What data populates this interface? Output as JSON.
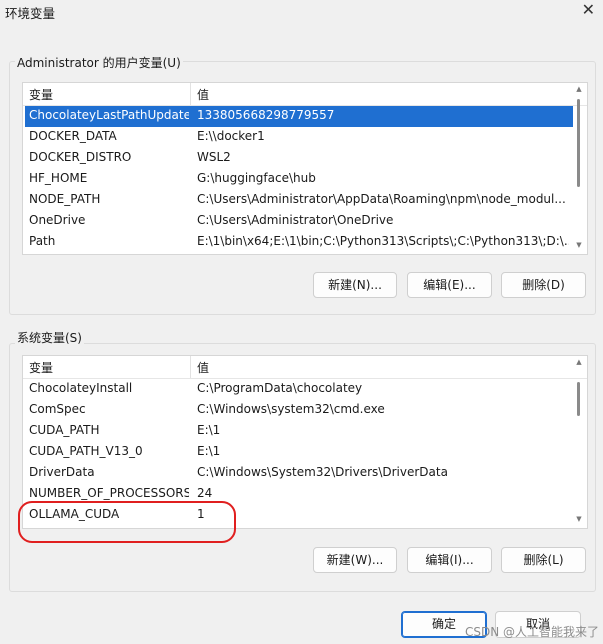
{
  "window": {
    "title": "环境变量",
    "close_glyph": "✕"
  },
  "user_group": {
    "label": "Administrator 的用户变量(U)",
    "columns": {
      "name": "变量",
      "value": "值"
    },
    "rows": [
      {
        "name": "ChocolateyLastPathUpdate",
        "value": "133805668298779557",
        "selected": true
      },
      {
        "name": "DOCKER_DATA",
        "value": "E:\\\\docker1"
      },
      {
        "name": "DOCKER_DISTRO",
        "value": "WSL2"
      },
      {
        "name": "HF_HOME",
        "value": "G:\\huggingface\\hub"
      },
      {
        "name": "NODE_PATH",
        "value": "C:\\Users\\Administrator\\AppData\\Roaming\\npm\\node_modul..."
      },
      {
        "name": "OneDrive",
        "value": "C:\\Users\\Administrator\\OneDrive"
      },
      {
        "name": "Path",
        "value": "E:\\1\\bin\\x64;E:\\1\\bin;C:\\Python313\\Scripts\\;C:\\Python313\\;D:\\..."
      }
    ],
    "buttons": {
      "new": "新建(N)...",
      "edit": "编辑(E)...",
      "delete": "删除(D)"
    }
  },
  "system_group": {
    "label": "系统变量(S)",
    "columns": {
      "name": "变量",
      "value": "值"
    },
    "rows": [
      {
        "name": "ChocolateyInstall",
        "value": "C:\\ProgramData\\chocolatey"
      },
      {
        "name": "ComSpec",
        "value": "C:\\Windows\\system32\\cmd.exe"
      },
      {
        "name": "CUDA_PATH",
        "value": "E:\\1"
      },
      {
        "name": "CUDA_PATH_V13_0",
        "value": "E:\\1"
      },
      {
        "name": "DriverData",
        "value": "C:\\Windows\\System32\\Drivers\\DriverData"
      },
      {
        "name": "NUMBER_OF_PROCESSORS",
        "value": "24"
      },
      {
        "name": "OLLAMA_CUDA",
        "value": "1"
      }
    ],
    "buttons": {
      "new": "新建(W)...",
      "edit": "编辑(I)...",
      "delete": "删除(L)"
    }
  },
  "footer": {
    "ok": "确定",
    "cancel": "取消"
  },
  "watermark": "CSDN @人工智能我来了",
  "colors": {
    "selection": "#1f6fd1",
    "annotation": "#e01f1f"
  }
}
